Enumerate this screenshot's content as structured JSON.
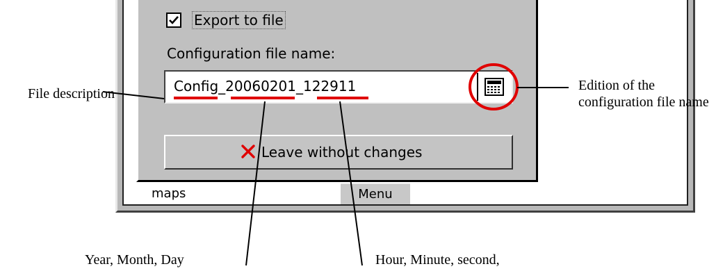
{
  "dialog": {
    "export_checkbox": {
      "label": "Export to file",
      "checked": true
    },
    "config_file_label": "Configuration file name:",
    "filename": {
      "prefix": "Config_",
      "date": "20060201",
      "sep": "_",
      "time": "122911"
    },
    "edit_icon": "calculator-icon",
    "leave_button": {
      "label": "Leave without changes",
      "icon": "red-x-icon"
    }
  },
  "bottom_tabs": [
    {
      "label": "maps"
    },
    {
      "label": "Menu"
    }
  ],
  "annotations": {
    "file_description": "File description",
    "edition": "Edition of the configuration file name",
    "date_parts": "Year, Month, Day",
    "time_parts": "Hour, Minute, second,"
  },
  "colors": {
    "highlight": "#e00000",
    "dialog_bg": "#c0c0c0",
    "tab_bg": "#c8c8c8"
  }
}
